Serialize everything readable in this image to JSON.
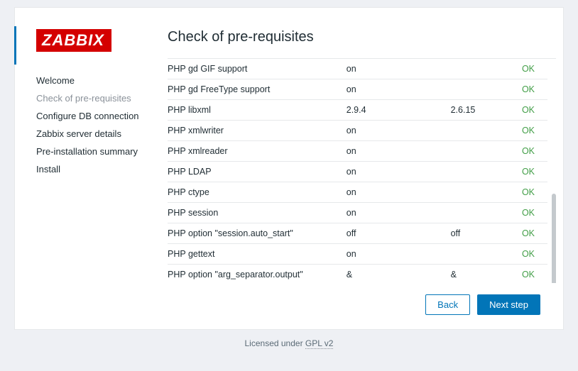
{
  "logo": "ZABBIX",
  "title": "Check of pre-requisites",
  "nav": [
    {
      "label": "Welcome",
      "active": false
    },
    {
      "label": "Check of pre-requisites",
      "active": true
    },
    {
      "label": "Configure DB connection",
      "active": false
    },
    {
      "label": "Zabbix server details",
      "active": false
    },
    {
      "label": "Pre-installation summary",
      "active": false
    },
    {
      "label": "Install",
      "active": false
    }
  ],
  "rows": [
    {
      "name": "PHP gd GIF support",
      "current": "on",
      "required": "",
      "status": "OK"
    },
    {
      "name": "PHP gd FreeType support",
      "current": "on",
      "required": "",
      "status": "OK"
    },
    {
      "name": "PHP libxml",
      "current": "2.9.4",
      "required": "2.6.15",
      "status": "OK"
    },
    {
      "name": "PHP xmlwriter",
      "current": "on",
      "required": "",
      "status": "OK"
    },
    {
      "name": "PHP xmlreader",
      "current": "on",
      "required": "",
      "status": "OK"
    },
    {
      "name": "PHP LDAP",
      "current": "on",
      "required": "",
      "status": "OK"
    },
    {
      "name": "PHP ctype",
      "current": "on",
      "required": "",
      "status": "OK"
    },
    {
      "name": "PHP session",
      "current": "on",
      "required": "",
      "status": "OK"
    },
    {
      "name": "PHP option \"session.auto_start\"",
      "current": "off",
      "required": "off",
      "status": "OK"
    },
    {
      "name": "PHP gettext",
      "current": "on",
      "required": "",
      "status": "OK"
    },
    {
      "name": "PHP option \"arg_separator.output\"",
      "current": "&",
      "required": "&",
      "status": "OK"
    }
  ],
  "buttons": {
    "back": "Back",
    "next": "Next step"
  },
  "footer": {
    "text": "Licensed under ",
    "link": "GPL v2"
  }
}
